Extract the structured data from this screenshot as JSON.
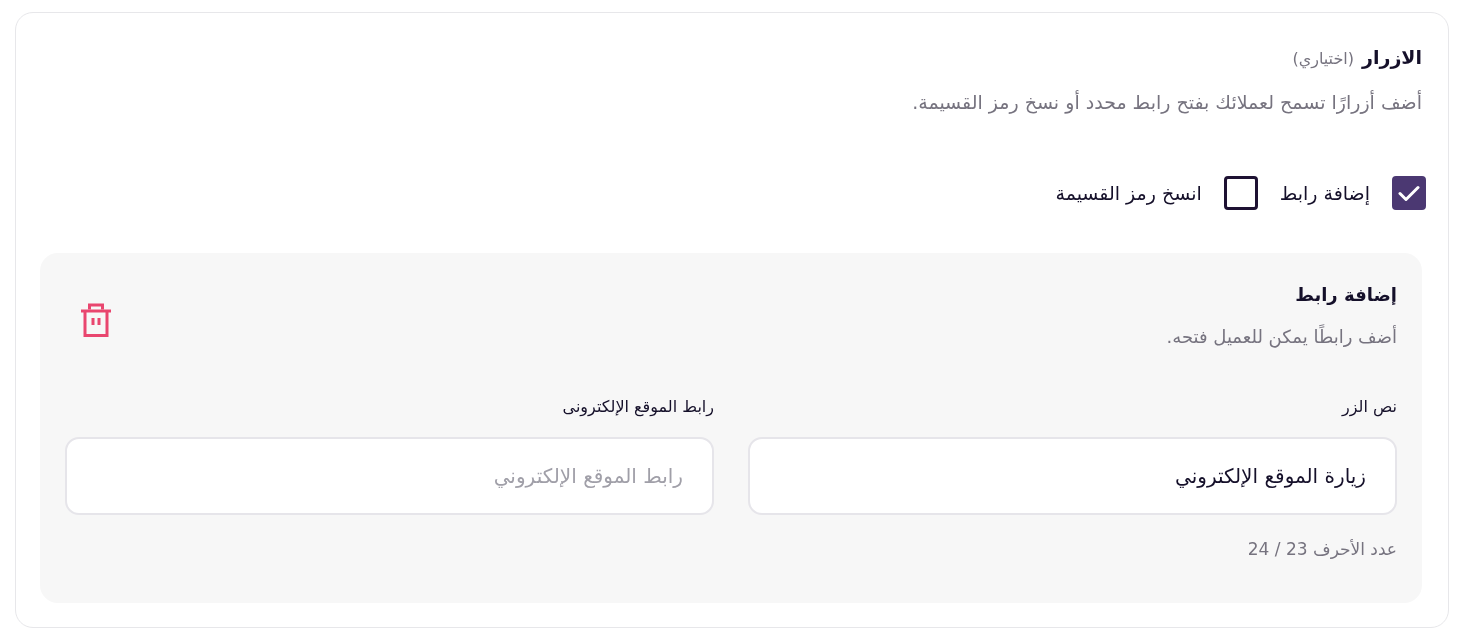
{
  "section": {
    "title": "الازرار",
    "optional": "(اختياري)",
    "description": "أضف أزرارًا تسمح لعملائك بفتح رابط محدد أو نسخ رمز القسيمة."
  },
  "options": [
    {
      "label": "إضافة رابط",
      "checked": true
    },
    {
      "label": "انسخ رمز القسيمة",
      "checked": false
    }
  ],
  "panels": [
    {
      "title": "إضافة رابط",
      "description": "أضف رابطًا يمكن للعميل فتحه.",
      "fields": [
        {
          "label": "نص الزر",
          "value": "زيارة الموقع الإلكتروني",
          "counter": "عدد الأحرف 23 / 24"
        },
        {
          "label": "رابط الموقع الإلكترونى",
          "placeholder": "رابط الموقع الإلكتروني"
        }
      ]
    }
  ]
}
